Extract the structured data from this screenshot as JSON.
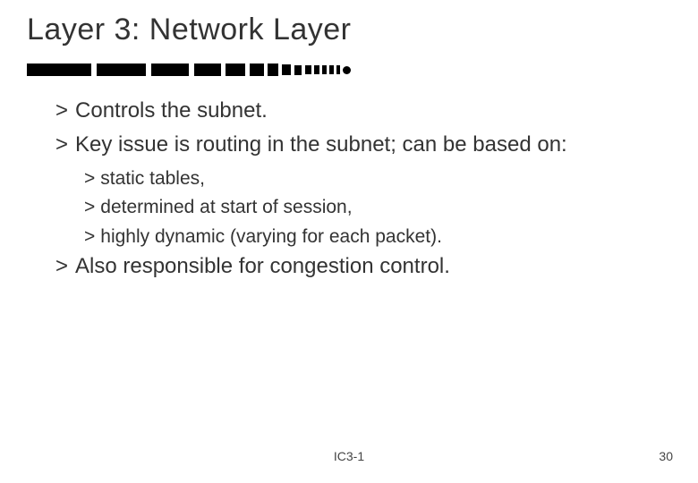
{
  "title": "Layer 3:  Network Layer",
  "bullets": [
    {
      "level": 1,
      "text": "Controls the subnet."
    },
    {
      "level": 1,
      "text": "Key issue is routing in the subnet; can be based on:"
    },
    {
      "level": 2,
      "text": "static tables,"
    },
    {
      "level": 2,
      "text": "determined at start of session,"
    },
    {
      "level": 2,
      "text": "highly dynamic (varying for each packet)."
    },
    {
      "level": 1,
      "text": "Also responsible for congestion control."
    }
  ],
  "marker": ">",
  "footer_center": "IC3-1",
  "footer_right": "30"
}
